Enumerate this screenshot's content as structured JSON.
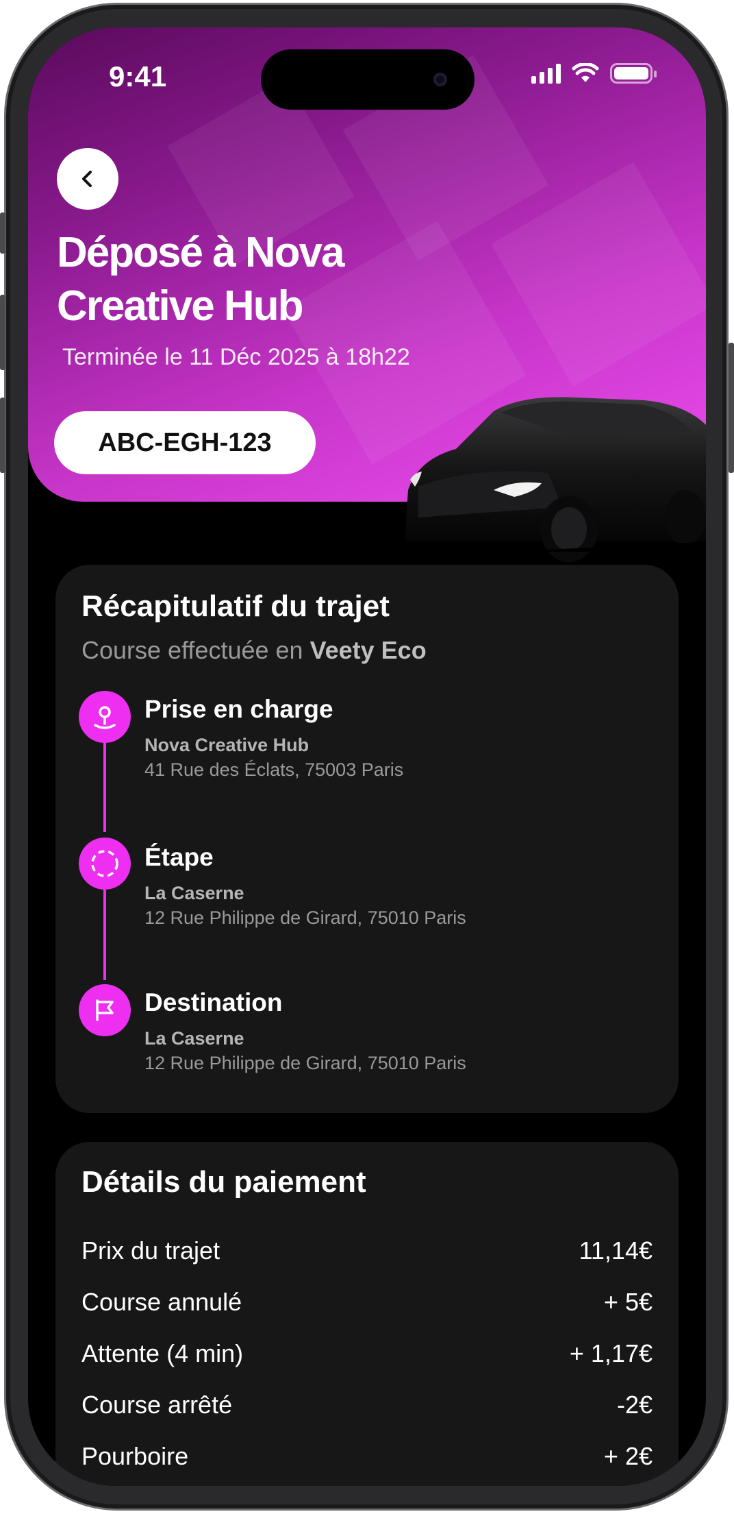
{
  "status_bar": {
    "time": "9:41"
  },
  "header": {
    "title": "Déposé à Nova Creative Hub",
    "subtitle": "Terminée le 11 Déc 2025 à 18h22",
    "plate": "ABC-EGH-123"
  },
  "trip_summary": {
    "title": "Récapitulatif du trajet",
    "subtitle_prefix": "Course effectuée en",
    "vehicle_class": "Veety Eco",
    "stops": [
      {
        "icon": "pin-icon",
        "type": "Prise en charge",
        "name": "Nova Creative Hub",
        "address": "41 Rue des Éclats, 75003 Paris"
      },
      {
        "icon": "dashed-circle-icon",
        "type": "Étape",
        "name": "La Caserne",
        "address": "12 Rue Philippe de Girard, 75010 Paris"
      },
      {
        "icon": "flag-icon",
        "type": "Destination",
        "name": "La Caserne",
        "address": "12 Rue Philippe de Girard, 75010 Paris"
      }
    ]
  },
  "payment": {
    "title": "Détails du paiement",
    "rows": [
      {
        "label": "Prix du trajet",
        "value": "11,14€"
      },
      {
        "label": "Course annulé",
        "value": "+ 5€"
      },
      {
        "label": "Attente (4 min)",
        "value": "+ 1,17€"
      },
      {
        "label": "Course arrêté",
        "value": "-2€"
      },
      {
        "label": "Pourboire",
        "value": "+ 2€"
      }
    ]
  },
  "colors": {
    "accent": "#ee2ef0",
    "card": "#171717",
    "background": "#000000"
  }
}
